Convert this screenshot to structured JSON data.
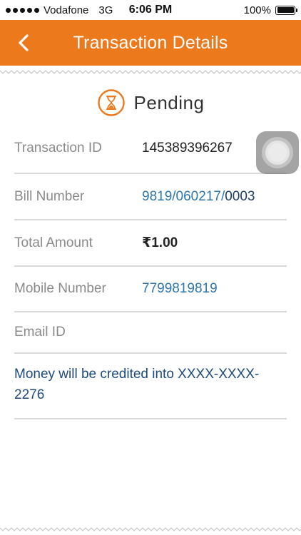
{
  "status_bar": {
    "carrier": "Vodafone",
    "network": "3G",
    "time": "6:06 PM",
    "battery": "100%"
  },
  "nav": {
    "title": "Transaction Details",
    "back_icon": "chevron-left-icon"
  },
  "status": {
    "icon": "hourglass-icon",
    "label": "Pending",
    "color": "#ec7a1d"
  },
  "fields": {
    "transaction_id": {
      "label": "Transaction ID",
      "value": "145389396267"
    },
    "bill_number": {
      "label": "Bill Number",
      "value_part1": "9819/060217/",
      "value_part2": "0003"
    },
    "total_amount": {
      "label": "Total Amount",
      "value": "₹1.00"
    },
    "mobile_number": {
      "label": "Mobile Number",
      "value": "7799819819"
    },
    "email_id": {
      "label": "Email ID",
      "value": ""
    }
  },
  "message": "Money will be credited into XXXX-XXXX-2276",
  "colors": {
    "brand": "#ec7a1d",
    "link": "#2d76ad",
    "message": "#1c4a7d",
    "label": "#8a8a8a"
  }
}
